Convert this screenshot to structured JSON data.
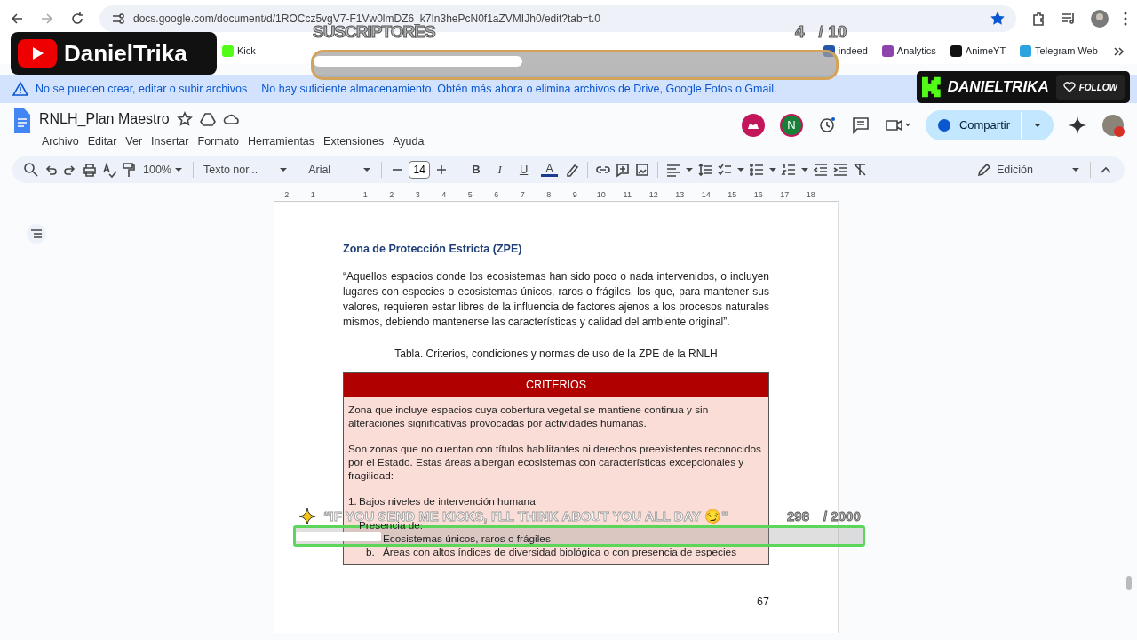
{
  "browser": {
    "url": "docs.google.com/document/d/1ROCcz5vgV7-F1Vw0lmDZ6_k7In3hePcN0f1aZVMIJh0/edit?tab=t.0"
  },
  "bookmarks": [
    {
      "label": "Kick",
      "color": "#53fc18"
    },
    {
      "label": "indeed",
      "color": "#2557a7"
    },
    {
      "label": "Analytics",
      "color": "#8e44ad"
    },
    {
      "label": "AnimeYT",
      "color": "#111111"
    },
    {
      "label": "Telegram Web",
      "color": "#2aa3df"
    }
  ],
  "banner": {
    "title": "No se pueden crear, editar o subir archivos",
    "message": "No hay suficiente almacenamiento. Obtén más ahora o elimina archivos de Drive, Google Fotos o Gmail."
  },
  "document": {
    "title": "RNLH_Plan Maestro",
    "menus": [
      "Archivo",
      "Editar",
      "Ver",
      "Insertar",
      "Formato",
      "Herramientas",
      "Extensiones",
      "Ayuda"
    ]
  },
  "collaborator_initial": "N",
  "share_button": "Compartir",
  "toolbar": {
    "zoom": "100%",
    "style": "Texto nor...",
    "font": "Arial",
    "font_size": "14",
    "format_buttons": [
      "B",
      "I",
      "U",
      "A"
    ],
    "mode": "Edición"
  },
  "ruler": {
    "left_ticks": [
      "2",
      "1"
    ],
    "right_ticks": [
      "1",
      "2",
      "3",
      "4",
      "5",
      "6",
      "7",
      "8",
      "9",
      "10",
      "11",
      "12",
      "13",
      "14",
      "15",
      "16",
      "17",
      "18"
    ]
  },
  "page": {
    "heading": "Zona de Protección Estricta (ZPE)",
    "quote": "“Aquellos espacios donde los ecosistemas han sido poco o nada intervenidos, o incluyen lugares con especies o ecosistemas únicos, raros o frágiles, los que, para mantener sus valores, requieren estar libres de la influencia de factores ajenos a los procesos naturales mismos, debiendo mantenerse las características y calidad del ambiente original”.",
    "caption": "Tabla. Criterios, condiciones y normas de uso de la ZPE de la RNLH",
    "table": {
      "header": "CRITERIOS",
      "paragraphs": [
        "Zona que incluye espacios cuya cobertura vegetal se mantiene continua y sin alteraciones significativas provocadas por actividades humanas.",
        "Son zonas que no cuentan con títulos habilitantes ni derechos preexistentes reconocidos por el Estado. Estas áreas albergan ecosistemas con características excepcionales y fragilidad:"
      ],
      "list": [
        {
          "marker": "1.",
          "text": "Bajos niveles de intervención humana"
        },
        {
          "text": "Presencia de:",
          "children": [
            {
              "text": "Ecosistemas únicos, raros o frágiles"
            },
            {
              "marker": "b.",
              "text": "Áreas con altos índices de diversidad biológica o con presencia de especies"
            }
          ]
        }
      ]
    },
    "page_number": "67"
  },
  "stream_overlays": {
    "channel_badge": "DanielTrika",
    "sub_goal": {
      "label": "SUSCRIPTORES",
      "count": "4",
      "target": "/ 10",
      "level": 0.4
    },
    "kick_badge": {
      "name": "DANIELTRIKA",
      "follow": "FOLLOW"
    },
    "kick_goal": {
      "message": "“IF YOU SEND ME KICKS, I'LL THINK ABOUT YOU ALL DAY 😏”",
      "count": "298",
      "target": "/ 2000",
      "level": 0.15
    }
  }
}
